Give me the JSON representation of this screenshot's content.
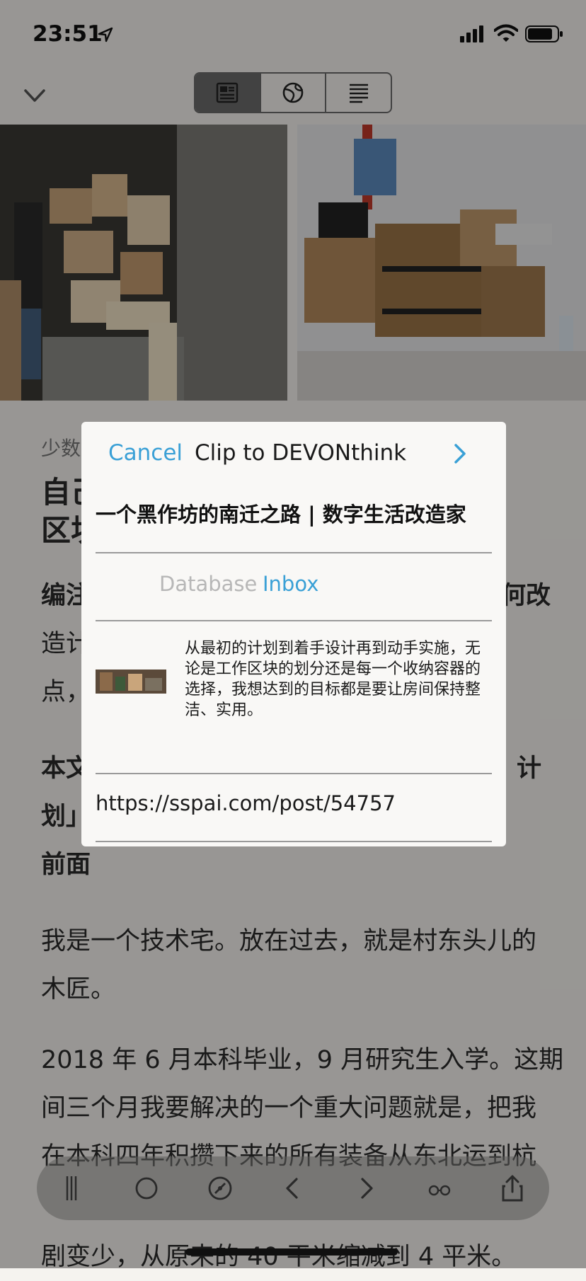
{
  "status_bar": {
    "time": "23:51"
  },
  "nav": {
    "segments": [
      "reader-view-icon",
      "web-view-icon",
      "text-view-icon"
    ],
    "active_segment": 0
  },
  "article": {
    "category_partial": "少数",
    "headline_line1_partial": "自己",
    "headline_line2_partial": "区块",
    "editor_note_partial": "编注",
    "editor_note_right": "何改",
    "note_line2_partial": "造计",
    "note_line3_partial": "点，",
    "bold_line1_partial": "本文",
    "bold_line1_right": "计",
    "bold_line2_partial": "划」",
    "bold_line3": "前面",
    "para1_line1": "我是一个技术宅。放在过去，就是村东头儿的",
    "para1_line2": "木匠。",
    "para2_line1": "2018 年 6 月本科毕业，9 月研究生入学。这期",
    "para2_line2": "间三个月我要解决的一个重大问题就是，把我",
    "para2_line3_partial": "在本科四年积攒下来的所有装备从东北运到杭",
    "para2_line4": "剧变少，从原来的 40 平米缩减到 4 平米。"
  },
  "modal": {
    "cancel_label": "Cancel",
    "title": "Clip to DEVONthink",
    "doc_title": "一个黑作坊的南迁之路 | 数字生活改造家",
    "database_label": "Database",
    "database_value": "Inbox",
    "excerpt": "从最初的计划到着手设计再到动手实施，无论是工作区块的划分还是每一个收纳容器的选择，我想达到的目标都是要让房间保持整洁、实用。",
    "url": "https://sspai.com/post/54757"
  },
  "toolbar": {
    "icons": [
      "sidebar-icon",
      "circle-icon",
      "compass-icon",
      "back-icon",
      "forward-icon",
      "reading-glasses-icon",
      "share-icon"
    ]
  },
  "colors": {
    "accent": "#3aa0d6",
    "overlay": "rgba(0,0,0,0.38)"
  }
}
